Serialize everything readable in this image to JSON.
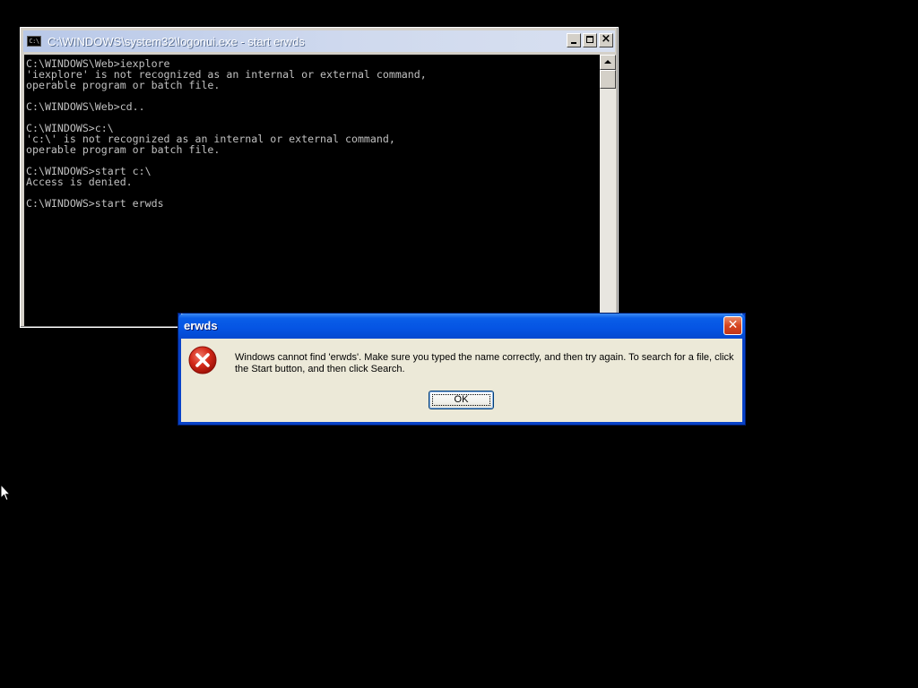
{
  "console": {
    "title": "C:\\WINDOWS\\system32\\logonui.exe - start erwds",
    "icon": "console-icon",
    "icon_text": "C:\\",
    "lines": [
      "C:\\WINDOWS\\Web>iexplore",
      "'iexplore' is not recognized as an internal or external command,",
      "operable program or batch file.",
      "",
      "C:\\WINDOWS\\Web>cd..",
      "",
      "C:\\WINDOWS>c:\\",
      "'c:\\' is not recognized as an internal or external command,",
      "operable program or batch file.",
      "",
      "C:\\WINDOWS>start c:\\",
      "Access is denied.",
      "",
      "C:\\WINDOWS>start erwds"
    ]
  },
  "dialog": {
    "title": "erwds",
    "icon": "error-icon",
    "message": "Windows cannot find 'erwds'. Make sure you typed the name correctly, and then try again. To search for a file, click the Start button, and then click Search.",
    "ok_label": "OK"
  },
  "colors": {
    "desktop": "#000000",
    "console_text": "#c0c0c0",
    "dialog_title_bar": "#0554e3",
    "error_red": "#d42a1a"
  }
}
